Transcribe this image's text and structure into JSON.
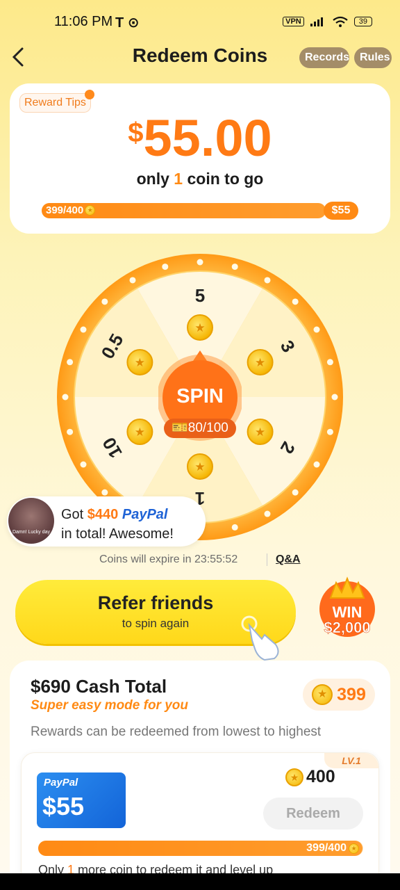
{
  "status_bar": {
    "time": "11:06 PM",
    "left_icons": "T ⊙",
    "vpn": "VPN",
    "battery": "39"
  },
  "header": {
    "title": "Redeem Coins",
    "records_label": "Records",
    "rules_label": "Rules"
  },
  "reward_card": {
    "tips_label": "Reward Tips",
    "currency": "$",
    "amount": "55.00",
    "subtitle_prefix": "only ",
    "subtitle_count": "1",
    "subtitle_suffix": " coin to go",
    "progress_label": "399/400",
    "progress_fraction": 0.9975,
    "goal_label": "$55"
  },
  "wheel": {
    "segments": [
      "5",
      "3",
      "2",
      "1",
      "10",
      "0.5"
    ],
    "spin_label": "SPIN",
    "spin_count": "80/100"
  },
  "toast": {
    "got": "Got ",
    "amount": "$440",
    "brand": "PayPal",
    "line2": "in total! Awesome!",
    "avatar_caption": "Damn! Lucky day"
  },
  "expire": {
    "text": "Coins will expire in 23:55:52",
    "qa_label": "Q&A"
  },
  "refer": {
    "title": "Refer friends",
    "subtitle": "to spin again",
    "win_label_1": "WIN",
    "win_label_2": "$2,000"
  },
  "cash": {
    "title": "$690 Cash Total",
    "subtitle": "Super easy mode for you",
    "coin_balance": "399",
    "rule_text": "Rewards can be redeemed from lowest to highest",
    "tier": {
      "level": "LV.1",
      "brand": "PayPal",
      "amount": "$55",
      "cost": "400",
      "redeem_label": "Redeem",
      "progress_label": "399/400",
      "progress_fraction": 0.9975,
      "note_prefix": "Only ",
      "note_count": "1",
      "note_suffix": " more coin to redeem it and level up"
    }
  },
  "colors": {
    "accent": "#ff7a14",
    "background": "#fde98a",
    "paypal": "#1f63d6"
  }
}
